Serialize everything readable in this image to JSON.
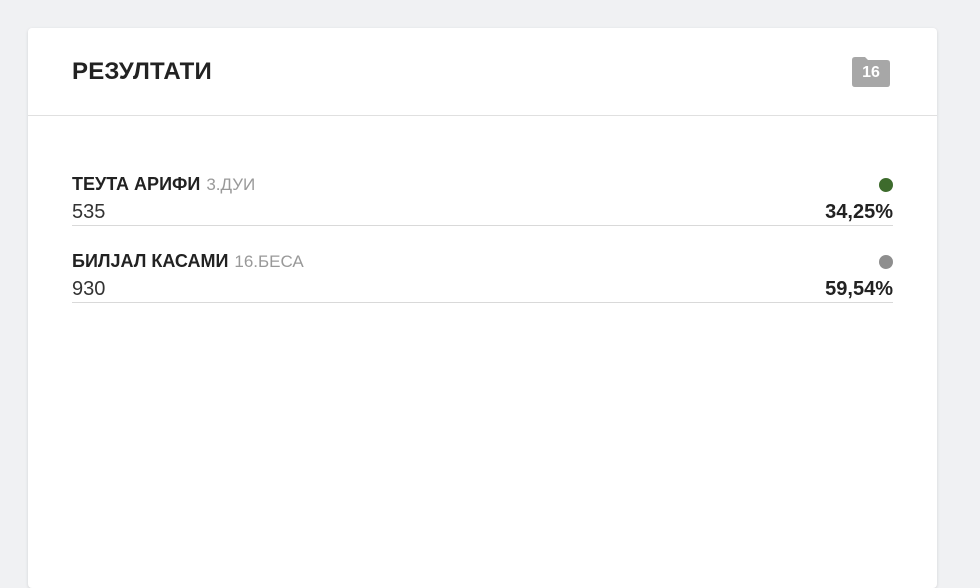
{
  "panel": {
    "title": "РЕЗУЛТАТИ",
    "badge_count": "16"
  },
  "results": [
    {
      "name": "ТЕУТА АРИФИ",
      "party": "3.ДУИ",
      "votes": "535",
      "percent": "34,25%",
      "color": "#3d6b2c"
    },
    {
      "name": "БИЛЈАЛ КАСАМИ",
      "party": "16.БЕСА",
      "votes": "930",
      "percent": "59,54%",
      "color": "#8e8e8e"
    }
  ]
}
